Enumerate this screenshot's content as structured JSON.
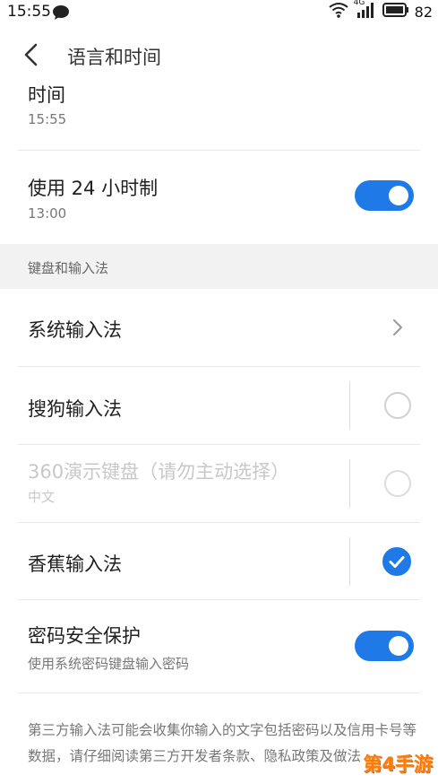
{
  "status_bar": {
    "time": "15:55",
    "network": "4G",
    "battery": "82"
  },
  "header": {
    "title": "语言和时间"
  },
  "time_row": {
    "label": "时间",
    "value": "15:55"
  },
  "hour24_row": {
    "label": "使用 24 小时制",
    "value": "13:00",
    "enabled": true
  },
  "section": {
    "label": "键盘和输入法"
  },
  "system_ime": {
    "label": "系统输入法"
  },
  "ime_list": [
    {
      "label": "搜狗输入法",
      "sub": "",
      "selected": false,
      "disabled": false
    },
    {
      "label": "360演示键盘（请勿主动选择）",
      "sub": "中文",
      "selected": false,
      "disabled": true
    },
    {
      "label": "香蕉输入法",
      "sub": "",
      "selected": true,
      "disabled": false
    }
  ],
  "password_row": {
    "label": "密码安全保护",
    "sub": "使用系统密码键盘输入密码",
    "enabled": true
  },
  "footer": {
    "text": "第三方输入法可能会收集你输入的文字包括密码以及信用卡号等数据，请仔细阅读第三方开发者条款、隐私政策及做法"
  },
  "watermark": {
    "text": "第4手游"
  },
  "colors": {
    "accent": "#1f7ae8",
    "section_bg": "#f2f2f2",
    "disabled_text": "#c8c8c8"
  }
}
